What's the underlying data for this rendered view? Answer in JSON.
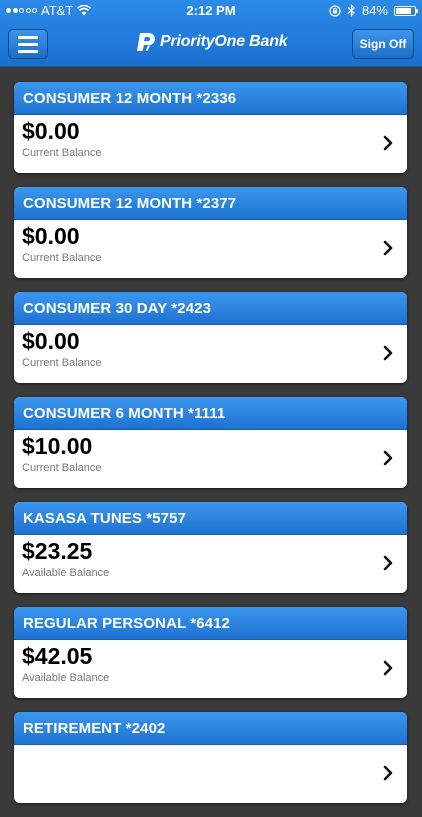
{
  "status_bar": {
    "carrier": "AT&T",
    "time": "2:12 PM",
    "battery": "84%",
    "battery_level": 0.84,
    "signal_bars_filled": 2,
    "signal_bars_total": 5,
    "icons": [
      "wifi-icon",
      "rotation-lock-icon",
      "bluetooth-icon",
      "battery-icon"
    ]
  },
  "header": {
    "menu_icon": "hamburger-menu-icon",
    "logo_text": "PriorityOne Bank",
    "sign_off_label": "Sign Off"
  },
  "accounts": [
    {
      "name": "CONSUMER 12 MONTH *2336",
      "amount": "$0.00",
      "balance_label": "Current Balance"
    },
    {
      "name": "CONSUMER 12 MONTH *2377",
      "amount": "$0.00",
      "balance_label": "Current Balance"
    },
    {
      "name": "CONSUMER 30 DAY *2423",
      "amount": "$0.00",
      "balance_label": "Current Balance"
    },
    {
      "name": "CONSUMER 6 MONTH *1111",
      "amount": "$10.00",
      "balance_label": "Current Balance"
    },
    {
      "name": "KASASA TUNES *5757",
      "amount": "$23.25",
      "balance_label": "Available Balance"
    },
    {
      "name": "REGULAR PERSONAL *6412",
      "amount": "$42.05",
      "balance_label": "Available Balance"
    },
    {
      "name": "RETIREMENT *2402",
      "amount": "",
      "balance_label": ""
    }
  ],
  "colors": {
    "header_blue": "#1f78d6",
    "card_header_blue": "#2b85e2",
    "background": "#3a3a3a",
    "card_body": "#ffffff"
  }
}
